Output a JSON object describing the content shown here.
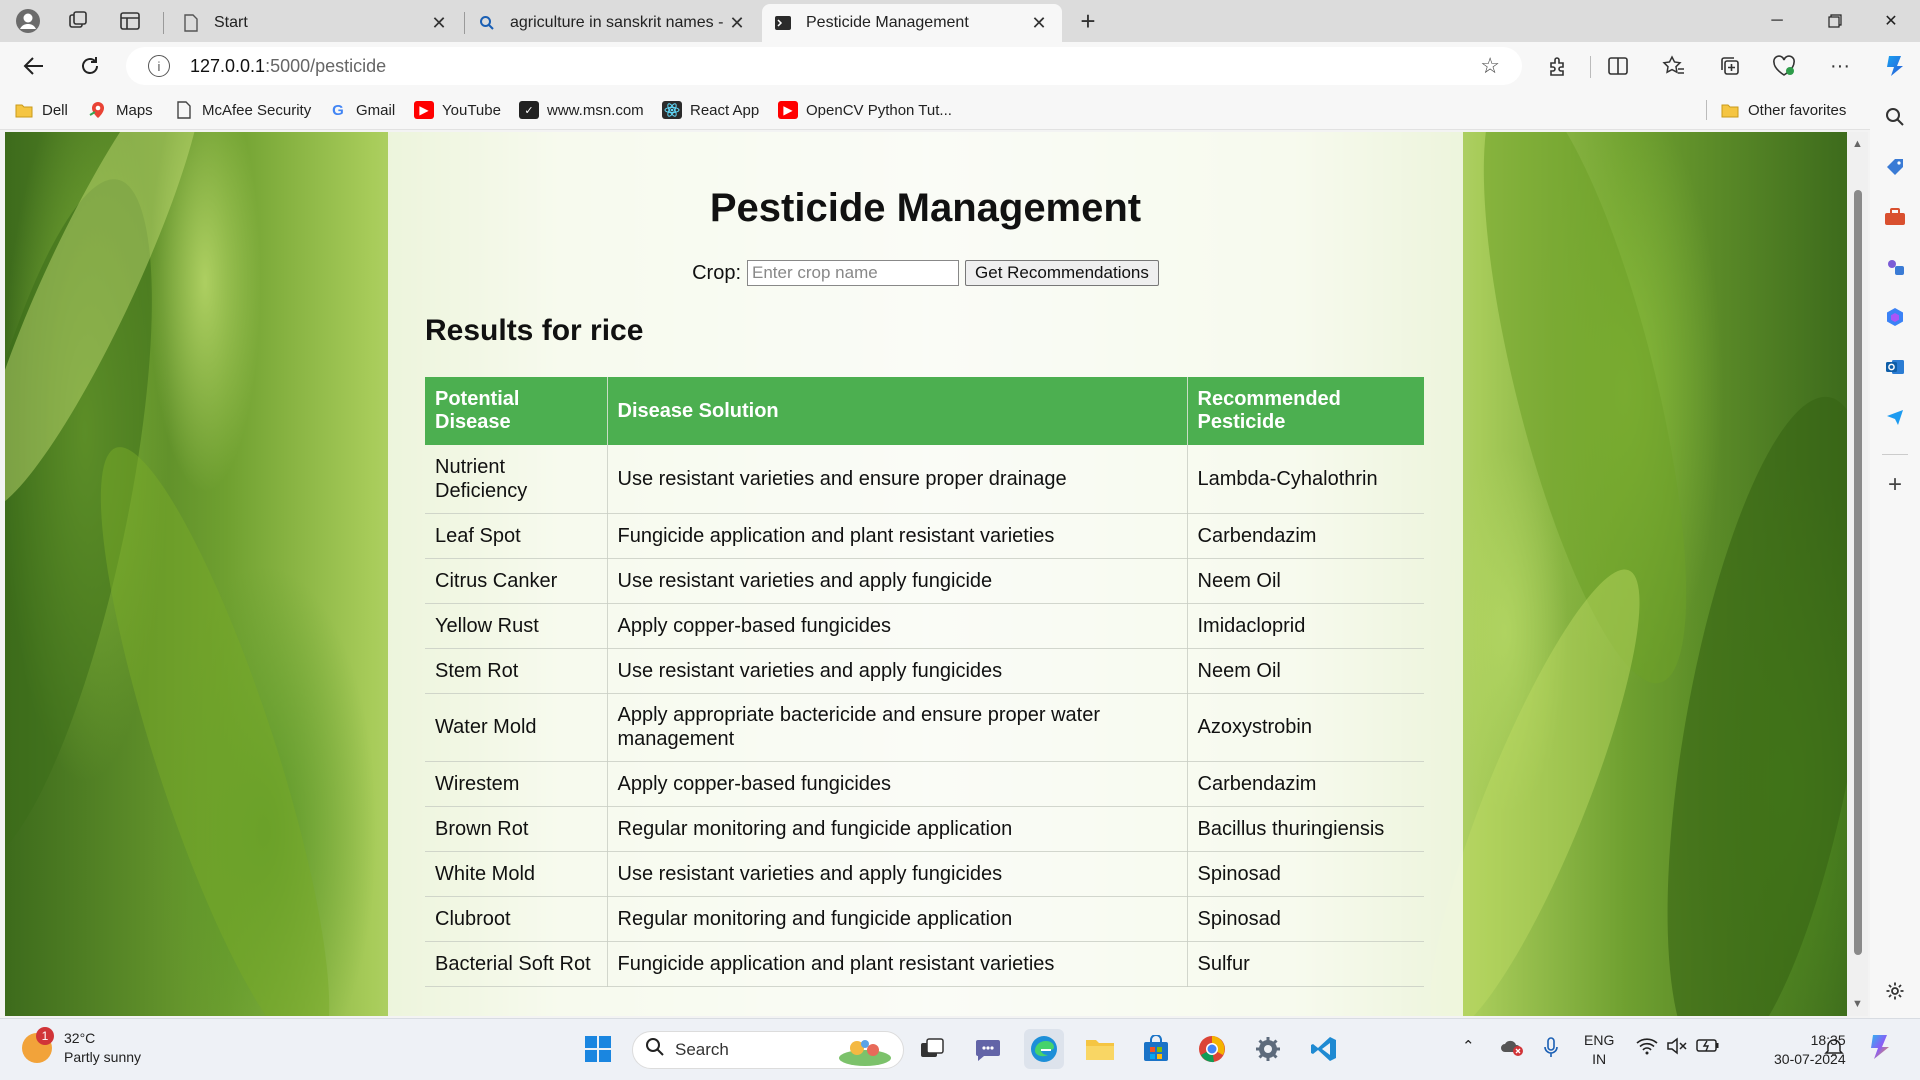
{
  "browser": {
    "tabs": [
      {
        "title": "Start",
        "active": false
      },
      {
        "title": "agriculture in sanskrit names - Se",
        "active": false
      },
      {
        "title": "Pesticide Management",
        "active": true
      }
    ],
    "url_host": "127.0.0.1",
    "url_path": ":5000/pesticide",
    "bookmarks": [
      "Dell",
      "Maps",
      "McAfee Security",
      "Gmail",
      "YouTube",
      "www.msn.com",
      "React App",
      "OpenCV Python Tut..."
    ],
    "other_favorites": "Other favorites"
  },
  "page": {
    "heading": "Pesticide Management",
    "crop_label": "Crop:",
    "crop_placeholder": "Enter crop name",
    "button_label": "Get Recommendations",
    "results_title": "Results for rice",
    "columns": [
      "Potential Disease",
      "Disease Solution",
      "Recommended Pesticide"
    ],
    "rows": [
      {
        "disease": "Nutrient Deficiency",
        "solution": "Use resistant varieties and ensure proper drainage",
        "pesticide": "Lambda-Cyhalothrin"
      },
      {
        "disease": "Leaf Spot",
        "solution": "Fungicide application and plant resistant varieties",
        "pesticide": "Carbendazim"
      },
      {
        "disease": "Citrus Canker",
        "solution": "Use resistant varieties and apply fungicide",
        "pesticide": "Neem Oil"
      },
      {
        "disease": "Yellow Rust",
        "solution": "Apply copper-based fungicides",
        "pesticide": "Imidacloprid"
      },
      {
        "disease": "Stem Rot",
        "solution": "Use resistant varieties and apply fungicides",
        "pesticide": "Neem Oil"
      },
      {
        "disease": "Water Mold",
        "solution": "Apply appropriate bactericide and ensure proper water management",
        "pesticide": "Azoxystrobin"
      },
      {
        "disease": "Wirestem",
        "solution": "Apply copper-based fungicides",
        "pesticide": "Carbendazim"
      },
      {
        "disease": "Brown Rot",
        "solution": "Regular monitoring and fungicide application",
        "pesticide": "Bacillus thuringiensis"
      },
      {
        "disease": "White Mold",
        "solution": "Use resistant varieties and apply fungicides",
        "pesticide": "Spinosad"
      },
      {
        "disease": "Clubroot",
        "solution": "Regular monitoring and fungicide application",
        "pesticide": "Spinosad"
      },
      {
        "disease": "Bacterial Soft Rot",
        "solution": "Fungicide application and plant resistant varieties",
        "pesticide": "Sulfur"
      }
    ],
    "header_color": "#4caf50"
  },
  "taskbar": {
    "weather_temp": "32°C",
    "weather_desc": "Partly sunny",
    "weather_badge": "1",
    "search_label": "Search",
    "lang_line1": "ENG",
    "lang_line2": "IN",
    "time": "18:35",
    "date": "30-07-2024"
  }
}
